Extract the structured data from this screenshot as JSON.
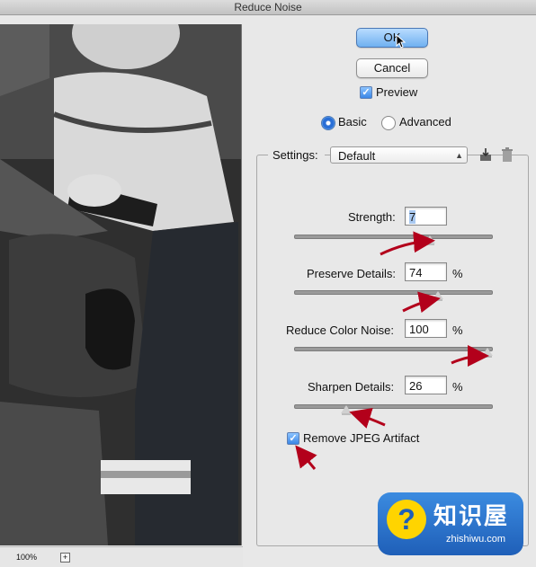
{
  "window": {
    "title": "Reduce Noise"
  },
  "preview": {
    "zoom": "100%",
    "zoom_plus": "+"
  },
  "buttons": {
    "ok": "OK",
    "cancel": "Cancel"
  },
  "preview_toggle": {
    "label": "Preview",
    "checked": true
  },
  "mode": {
    "basic": "Basic",
    "advanced": "Advanced",
    "selected": "Basic"
  },
  "settings": {
    "label": "Settings:",
    "value": "Default"
  },
  "sliders": {
    "strength": {
      "label": "Strength:",
      "value": "7",
      "unit": "",
      "max": 10
    },
    "preserve": {
      "label": "Preserve Details:",
      "value": "74",
      "unit": "%",
      "max": 100
    },
    "color_noise": {
      "label": "Reduce Color Noise:",
      "value": "100",
      "unit": "%",
      "max": 100
    },
    "sharpen": {
      "label": "Sharpen Details:",
      "value": "26",
      "unit": "%",
      "max": 100
    }
  },
  "jpeg": {
    "label": "Remove JPEG Artifact",
    "checked": true
  },
  "watermark": {
    "title": "知识屋",
    "sub": "zhishiwu.com",
    "symbol": "?"
  },
  "colors": {
    "accent": "#3a86e6",
    "annotation_arrow": "#b3001b"
  }
}
